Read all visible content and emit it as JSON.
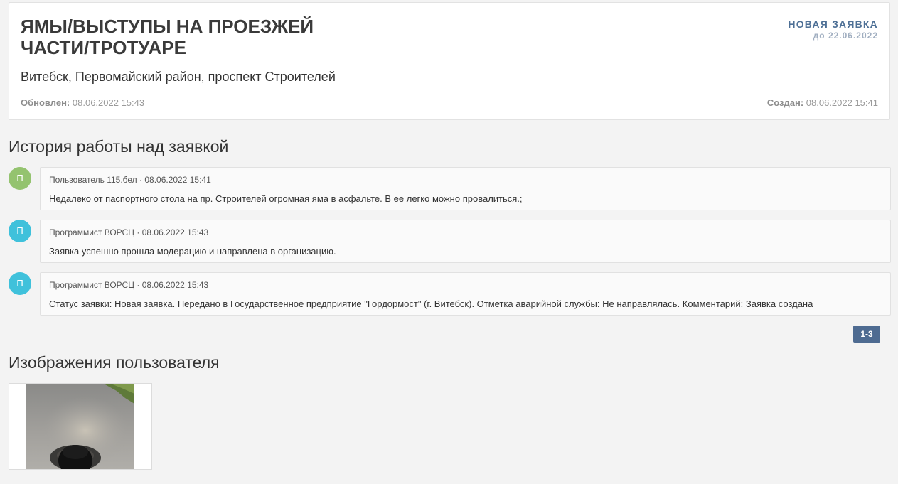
{
  "request": {
    "title": "ЯМЫ/ВЫСТУПЫ НА ПРОЕЗЖЕЙ ЧАСТИ/ТРОТУАРЕ",
    "address": "Витебск, Первомайский район, проспект Строителей",
    "status_label": "НОВАЯ ЗАЯВКА",
    "deadline": "до 22.06.2022",
    "updated_label": "Обновлен:",
    "updated_value": "08.06.2022 15:43",
    "created_label": "Создан:",
    "created_value": "08.06.2022 15:41"
  },
  "history": {
    "title": "История работы над заявкой",
    "entries": [
      {
        "avatar": "П",
        "avatar_color": "#94c36f",
        "meta": "Пользователь 115.бел · 08.06.2022 15:41",
        "text": "Недалеко от паспортного стола на пр. Строителей огромная яма в асфальте. В ее легко можно провалиться.;"
      },
      {
        "avatar": "П",
        "avatar_color": "#3fc1db",
        "meta": "Программист ВОРСЦ · 08.06.2022 15:43",
        "text": "Заявка успешно прошла модерацию и направлена в организацию."
      },
      {
        "avatar": "П",
        "avatar_color": "#3fc1db",
        "meta": "Программист ВОРСЦ · 08.06.2022 15:43",
        "text": "Статус заявки: Новая заявка. Передано в Государственное предприятие \"Гордормост\" (г. Витебск). Отметка аварийной службы: Не направлялась. Комментарий: Заявка создана"
      }
    ],
    "pager_label": "1-3"
  },
  "images": {
    "title": "Изображения пользователя"
  }
}
